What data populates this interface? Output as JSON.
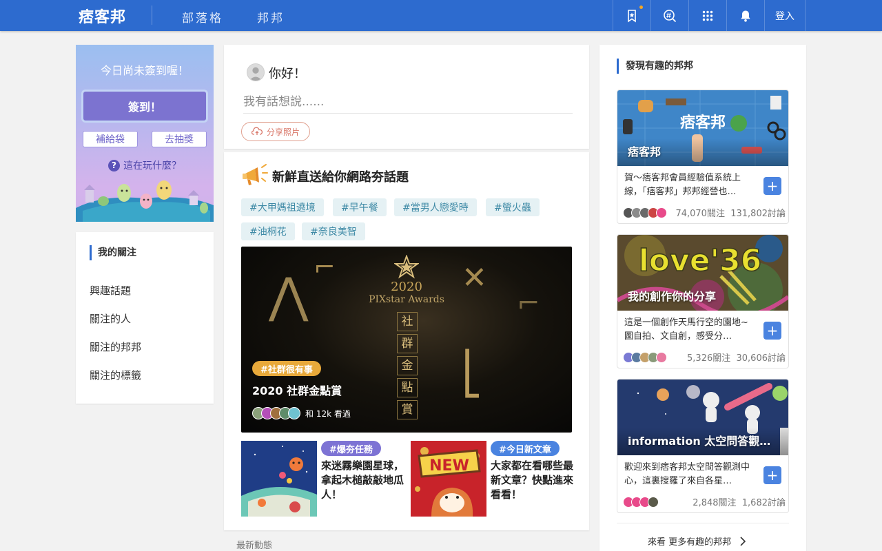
{
  "header": {
    "logo": "痞客邦",
    "nav": [
      "部落格",
      "邦邦"
    ],
    "login_label": "登入",
    "icons": [
      "bookmark-star-icon",
      "search-hashtag-icon",
      "apps-grid-icon",
      "bell-icon"
    ],
    "colors": {
      "bar": "#2d6bcf",
      "dot": "#f5a623"
    }
  },
  "checkin": {
    "title": "今日尚未簽到喔！",
    "button": "簽到！",
    "buy": "補給袋",
    "draw": "去抽獎",
    "howto": "這在玩什麼？"
  },
  "follow": {
    "title": "我的關注",
    "items": [
      "興趣話題",
      "關注的人",
      "關注的邦邦",
      "關注的標籤"
    ]
  },
  "compose": {
    "greeting": "你好！",
    "placeholder": "我有話想說......",
    "share_photo": "分享照片"
  },
  "feed": {
    "title": "新鮮直送給你網路夯話題",
    "tags": [
      "#大甲媽祖遶境",
      "#早午餐",
      "#當男人戀愛時",
      "#螢火蟲",
      "#油桐花",
      "#奈良美智"
    ],
    "hero": {
      "year": "2020",
      "award": "PIXstar Awards",
      "vertical": [
        "社",
        "群",
        "金",
        "點",
        "賞"
      ],
      "badge": "#社群很有事",
      "title": "2020 社群金點賞",
      "viewers": "和 12k 看過"
    },
    "minis": [
      {
        "badge": "#爆夯任務",
        "text": "來迷霧樂園星球，拿起木槌敲敲地瓜人！",
        "badge_color": "#7d73d4"
      },
      {
        "badge": "#今日新文章",
        "text": "大家都在看哪些最新文章？快點進來看看！",
        "badge_color": "#4a83e0",
        "img_text": "NEW"
      }
    ],
    "latest": "最新動態"
  },
  "discover": {
    "title": "發現有趣的邦邦",
    "groups": [
      {
        "name": "痞客邦",
        "img_word": "痞客邦",
        "desc": "賀～痞客邦會員經驗值系統上線，「痞客邦」邦邦經營也…",
        "follows": "74,070關注",
        "discussions": "131,802討論"
      },
      {
        "name": "我的創作你的分享",
        "img_word": "love'36",
        "desc": "這是一個創作天馬行空的園地~圖自拍、文自創，感受分…",
        "follows": "5,326關注",
        "discussions": "30,606討論"
      },
      {
        "name": "information 太空問答觀…",
        "desc": "歡迎來到痞客邦太空問答觀測中心，這裏搜羅了來自各星…",
        "follows": "2,848關注",
        "discussions": "1,682討論"
      }
    ],
    "more": "來看 更多有趣的邦邦"
  }
}
